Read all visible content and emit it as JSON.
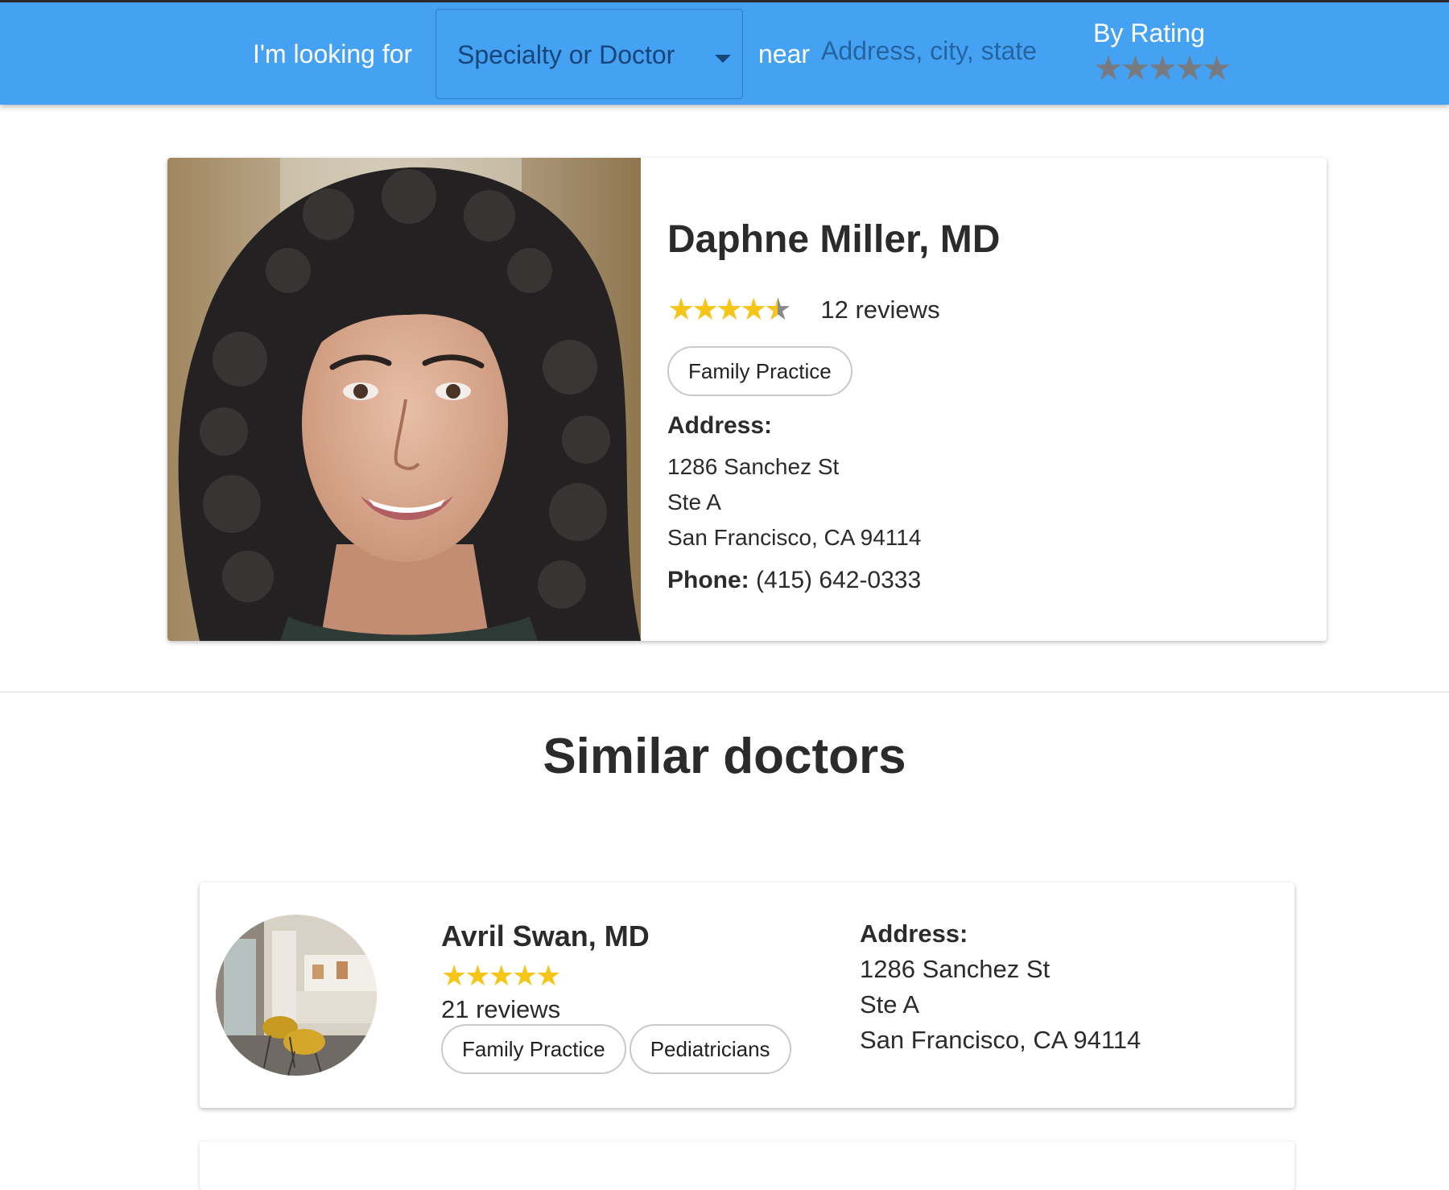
{
  "header": {
    "looking_for_label": "I'm looking for",
    "specialty_select": {
      "selected": "Specialty or Doctor"
    },
    "near_label": "near",
    "location_placeholder": "Address, city, state",
    "rating_filter": {
      "label": "By Rating",
      "stars": 5
    }
  },
  "featured": {
    "name": "Daphne Miller, MD",
    "rating": 4.5,
    "reviews": "12 reviews",
    "specialties": [
      "Family Practice"
    ],
    "address_label": "Address:",
    "address": [
      "1286 Sanchez St",
      "Ste A",
      "San Francisco, CA 94114"
    ],
    "phone_label": "Phone:",
    "phone": "(415) 642-0333"
  },
  "similar": {
    "title": "Similar doctors",
    "doctors": [
      {
        "name": "Avril Swan, MD",
        "rating": 5,
        "reviews": "21 reviews",
        "specialties": [
          "Family Practice",
          "Pediatricians"
        ],
        "address_label": "Address:",
        "address": [
          "1286 Sanchez St",
          "Ste A",
          "San Francisco, CA 94114"
        ]
      }
    ]
  },
  "colors": {
    "header_bg": "#45a2f3",
    "star_filled": "#f5c518",
    "star_empty": "#8a8a8a"
  },
  "icons": [
    "dropdown-caret-icon",
    "star-icon"
  ]
}
